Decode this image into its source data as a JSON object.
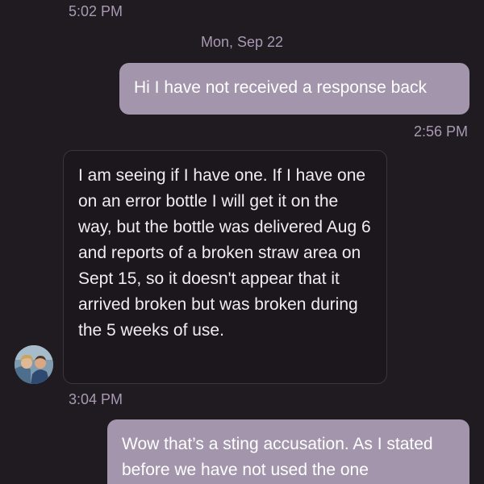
{
  "thread": {
    "top_timestamp": "5:02 PM",
    "date_separator": "Mon, Sep 22",
    "messages": [
      {
        "direction": "outgoing",
        "text": "Hi I have not received a response back",
        "time": "2:56 PM"
      },
      {
        "direction": "incoming",
        "text": "I am seeing if I have one.  If I have one on an error bottle I will get it on the way, but the bottle was delivered Aug 6 and reports of a broken straw area on Sept 15, so it doesn't appear that it arrived broken but was broken during the 5 weeks of use.",
        "time": "3:04 PM",
        "avatar_icon": "agent-avatar"
      },
      {
        "direction": "outgoing",
        "text": "Wow that’s a sting accusation. As I stated before we have not used the one"
      }
    ]
  },
  "colors": {
    "background": "#1f1b20",
    "outgoing_bubble": "#a396ac",
    "incoming_bubble": "#1b171c",
    "timestamp": "#a99ab3"
  }
}
